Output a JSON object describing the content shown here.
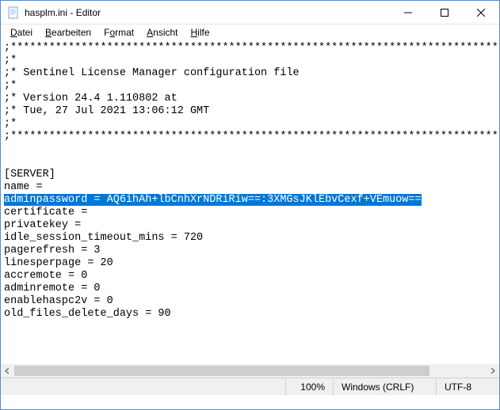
{
  "window": {
    "title": "hasplm.ini - Editor"
  },
  "menu": {
    "file": {
      "ul": "D",
      "rest": "atei"
    },
    "edit": {
      "ul": "B",
      "rest": "earbeiten"
    },
    "format": {
      "ul": "o",
      "pre": "F",
      "rest": "rmat"
    },
    "view": {
      "ul": "A",
      "rest": "nsicht"
    },
    "help": {
      "ul": "H",
      "rest": "ilfe"
    }
  },
  "content": {
    "lines_before": [
      ";*****************************************************************************",
      ";*",
      ";* Sentinel License Manager configuration file",
      ";*",
      ";* Version 24.4 1.110802 at",
      ";* Tue, 27 Jul 2021 13:06:12 GMT",
      ";*",
      ";*****************************************************************************",
      "",
      "",
      "[SERVER]",
      "name ="
    ],
    "highlighted": "adminpassword = AQ6ihAh+lbCnhXrNDRiRiw==:3XMGsJKlEbvCexf+VEmuow==",
    "lines_after": [
      "certificate =",
      "privatekey =",
      "idle_session_timeout_mins = 720",
      "pagerefresh = 3",
      "linesperpage = 20",
      "accremote = 0",
      "adminremote = 0",
      "enablehaspc2v = 0",
      "old_files_delete_days = 90"
    ]
  },
  "status": {
    "zoom": "100%",
    "line_ending": "Windows (CRLF)",
    "encoding": "UTF-8"
  }
}
